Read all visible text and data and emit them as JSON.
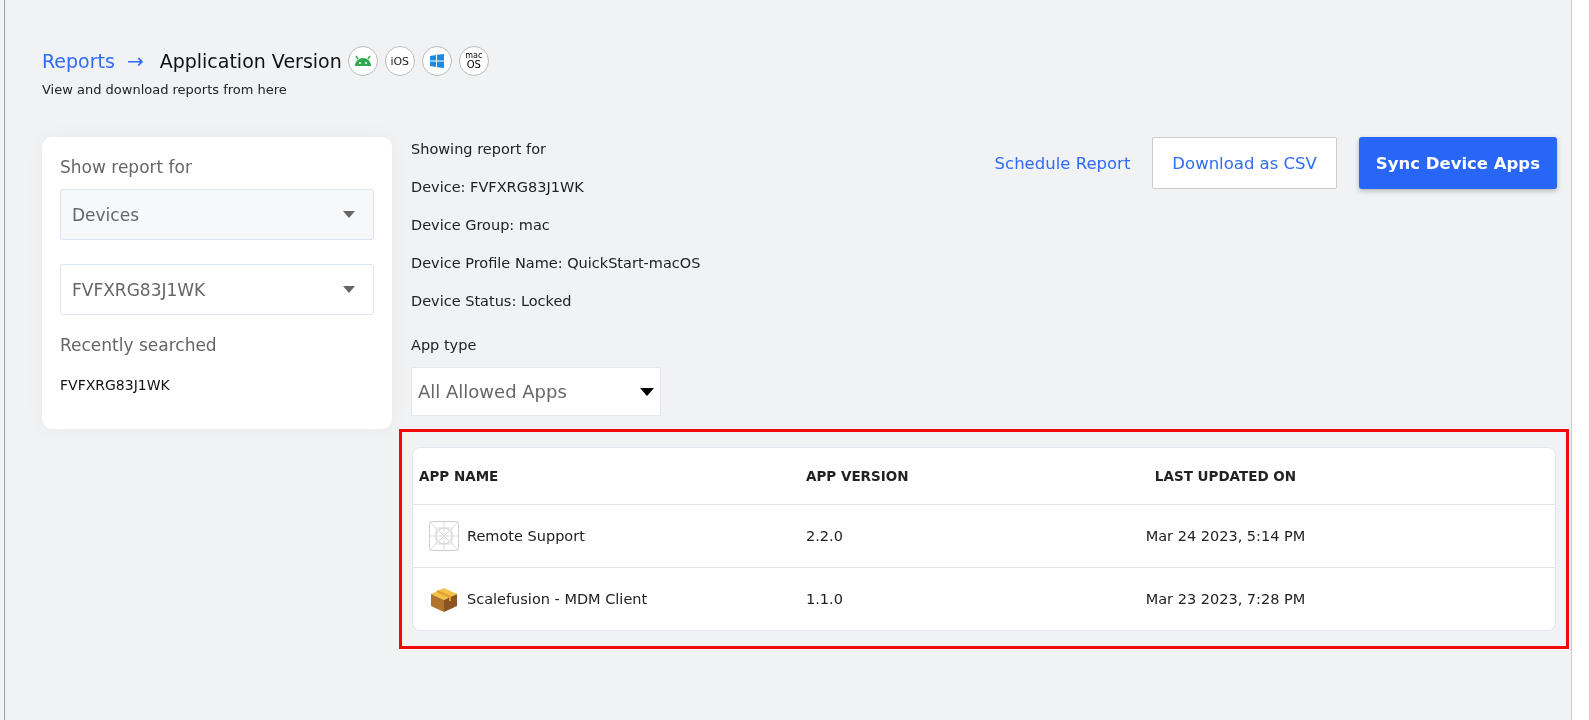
{
  "breadcrumb": {
    "parent": "Reports",
    "separator": "→",
    "current": "Application Version"
  },
  "platforms": [
    {
      "kind": "android"
    },
    {
      "kind": "text",
      "label": "iOS"
    },
    {
      "kind": "windows"
    },
    {
      "kind": "stacked",
      "small": "mac",
      "label": "OS"
    }
  ],
  "subtitle": "View and download reports from here",
  "filter_panel": {
    "title": "Show report for",
    "type_select": {
      "value": "Devices"
    },
    "device_select": {
      "value": "FVFXRG83J1WK"
    },
    "recent_title": "Recently searched",
    "recent": [
      "FVFXRG83J1WK"
    ]
  },
  "report_info": {
    "heading": "Showing report for",
    "lines": [
      "Device: FVFXRG83J1WK",
      "Device Group: mac",
      "Device Profile Name: QuickStart-macOS",
      "Device Status: Locked"
    ],
    "app_type_label": "App type",
    "app_type_value": "All Allowed Apps"
  },
  "actions": [
    {
      "kind": "link",
      "label": "Schedule Report"
    },
    {
      "kind": "outline",
      "label": "Download as CSV"
    },
    {
      "kind": "primary",
      "label": "Sync Device Apps"
    }
  ],
  "table": {
    "columns": [
      "APP NAME",
      "APP VERSION",
      "LAST UPDATED ON"
    ],
    "rows": [
      {
        "kind": "placeholder",
        "name": "Remote Support",
        "version": "2.2.0",
        "updated": "Mar 24 2023, 5:14 PM"
      },
      {
        "kind": "package",
        "name": "Scalefusion - MDM Client",
        "version": "1.1.0",
        "updated": "Mar 23 2023, 7:28 PM"
      }
    ]
  }
}
